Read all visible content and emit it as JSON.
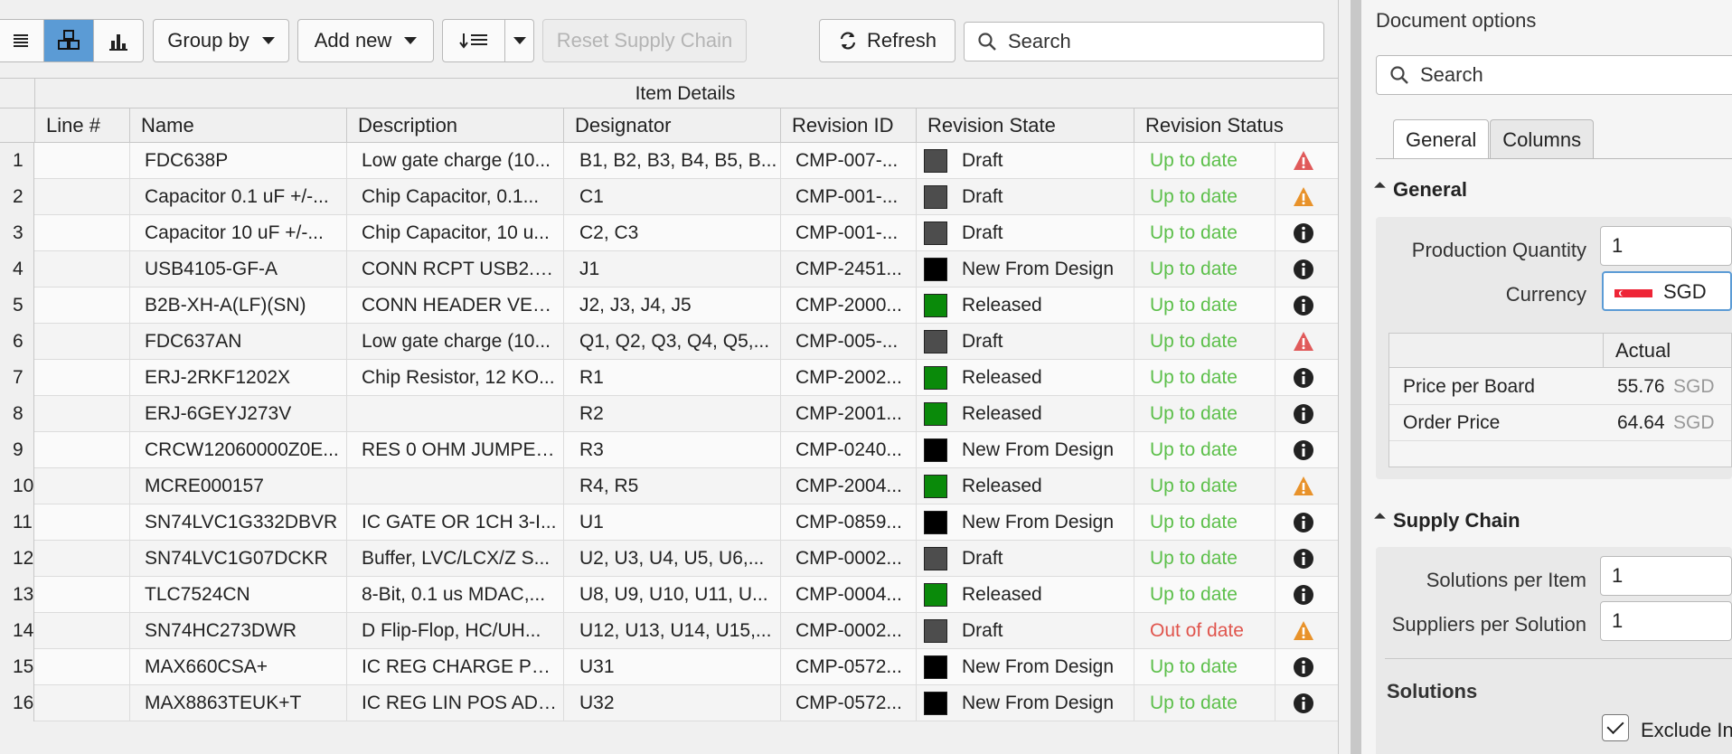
{
  "toolbar": {
    "group_by": "Group by",
    "add_new": "Add new",
    "reset": "Reset Supply Chain",
    "refresh": "Refresh",
    "search_placeholder": "Search"
  },
  "grid": {
    "group_header": "Item Details",
    "columns": [
      "Line #",
      "Name",
      "Description",
      "Designator",
      "Revision ID",
      "Revision State",
      "Revision Status"
    ],
    "rows": [
      {
        "n": "1",
        "name": "FDC638P",
        "desc": "Low gate charge (10...",
        "des": "B1, B2, B3, B4, B5, B...",
        "rev": "CMP-007-...",
        "state": "Draft",
        "color": "#4d4d4d",
        "status": "Up to date",
        "icon": "warning-red"
      },
      {
        "n": "2",
        "name": "Capacitor 0.1 uF +/-...",
        "desc": "Chip Capacitor, 0.1...",
        "des": "C1",
        "rev": "CMP-001-...",
        "state": "Draft",
        "color": "#4d4d4d",
        "status": "Up to date",
        "icon": "warning-orange"
      },
      {
        "n": "3",
        "name": "Capacitor 10 uF +/-...",
        "desc": "Chip Capacitor, 10 u...",
        "des": "C2, C3",
        "rev": "CMP-001-...",
        "state": "Draft",
        "color": "#4d4d4d",
        "status": "Up to date",
        "icon": "info"
      },
      {
        "n": "4",
        "name": "USB4105-GF-A",
        "desc": "CONN RCPT USB2.0...",
        "des": "J1",
        "rev": "CMP-2451...",
        "state": "New From Design",
        "color": "#000000",
        "status": "Up to date",
        "icon": "info"
      },
      {
        "n": "5",
        "name": "B2B-XH-A(LF)(SN)",
        "desc": "CONN HEADER VER...",
        "des": "J2, J3, J4, J5",
        "rev": "CMP-2000...",
        "state": "Released",
        "color": "#0a8a0a",
        "status": "Up to date",
        "icon": "info"
      },
      {
        "n": "6",
        "name": "FDC637AN",
        "desc": "Low gate charge (10...",
        "des": "Q1, Q2, Q3, Q4, Q5,...",
        "rev": "CMP-005-...",
        "state": "Draft",
        "color": "#4d4d4d",
        "status": "Up to date",
        "icon": "warning-red"
      },
      {
        "n": "7",
        "name": "ERJ-2RKF1202X",
        "desc": "Chip Resistor, 12 KO...",
        "des": "R1",
        "rev": "CMP-2002...",
        "state": "Released",
        "color": "#0a8a0a",
        "status": "Up to date",
        "icon": "info"
      },
      {
        "n": "8",
        "name": "ERJ-6GEYJ273V",
        "desc": "",
        "des": "R2",
        "rev": "CMP-2001...",
        "state": "Released",
        "color": "#0a8a0a",
        "status": "Up to date",
        "icon": "info"
      },
      {
        "n": "9",
        "name": "CRCW12060000Z0E...",
        "desc": "RES 0 OHM JUMPER...",
        "des": "R3",
        "rev": "CMP-0240...",
        "state": "New From Design",
        "color": "#000000",
        "status": "Up to date",
        "icon": "info"
      },
      {
        "n": "10",
        "name": "MCRE000157",
        "desc": "",
        "des": "R4, R5",
        "rev": "CMP-2004...",
        "state": "Released",
        "color": "#0a8a0a",
        "status": "Up to date",
        "icon": "warning-orange"
      },
      {
        "n": "11",
        "name": "SN74LVC1G332DBVR",
        "desc": "IC GATE OR 1CH 3-I...",
        "des": "U1",
        "rev": "CMP-0859...",
        "state": "New From Design",
        "color": "#000000",
        "status": "Up to date",
        "icon": "info"
      },
      {
        "n": "12",
        "name": "SN74LVC1G07DCKR",
        "desc": "Buffer, LVC/LCX/Z S...",
        "des": "U2, U3, U4, U5, U6,...",
        "rev": "CMP-0002...",
        "state": "Draft",
        "color": "#4d4d4d",
        "status": "Up to date",
        "icon": "info"
      },
      {
        "n": "13",
        "name": "TLC7524CN",
        "desc": "8-Bit, 0.1 us MDAC,...",
        "des": "U8, U9, U10, U11, U...",
        "rev": "CMP-0004...",
        "state": "Released",
        "color": "#0a8a0a",
        "status": "Up to date",
        "icon": "info"
      },
      {
        "n": "14",
        "name": "SN74HC273DWR",
        "desc": "D Flip-Flop, HC/UH...",
        "des": "U12, U13, U14, U15,...",
        "rev": "CMP-0002...",
        "state": "Draft",
        "color": "#4d4d4d",
        "status": "Out of date",
        "icon": "warning-orange"
      },
      {
        "n": "15",
        "name": "MAX660CSA+",
        "desc": "IC REG CHARGE PU...",
        "des": "U31",
        "rev": "CMP-0572...",
        "state": "New From Design",
        "color": "#000000",
        "status": "Up to date",
        "icon": "info"
      },
      {
        "n": "16",
        "name": "MAX8863TEUK+T",
        "desc": "IC REG LIN POS ADJ...",
        "des": "U32",
        "rev": "CMP-0572...",
        "state": "New From Design",
        "color": "#000000",
        "status": "Up to date",
        "icon": "info"
      }
    ]
  },
  "options": {
    "title": "Document options",
    "search_placeholder": "Search",
    "tabs": [
      "General",
      "Columns"
    ],
    "general_section": "General",
    "production_quantity_label": "Production Quantity",
    "production_quantity": "1",
    "currency_label": "Currency",
    "currency": "SGD",
    "price_header": "Actual",
    "price_rows": [
      {
        "label": "Price per Board",
        "value": "55.76",
        "unit": "SGD"
      },
      {
        "label": "Order Price",
        "value": "64.64",
        "unit": "SGD"
      }
    ],
    "supply_section": "Supply Chain",
    "solutions_per_item_label": "Solutions per Item",
    "solutions_per_item": "1",
    "suppliers_per_solution_label": "Suppliers per Solution",
    "suppliers_per_solution": "1",
    "solutions_label": "Solutions",
    "exclude_label": "Exclude Inv"
  },
  "colors": {
    "accent": "#5b9bd5",
    "up_to_date": "#5cbf4a",
    "out_of_date": "#e0554d",
    "warning_red": "#e05a5a",
    "warning_orange": "#e8922a",
    "info": "#222222"
  }
}
